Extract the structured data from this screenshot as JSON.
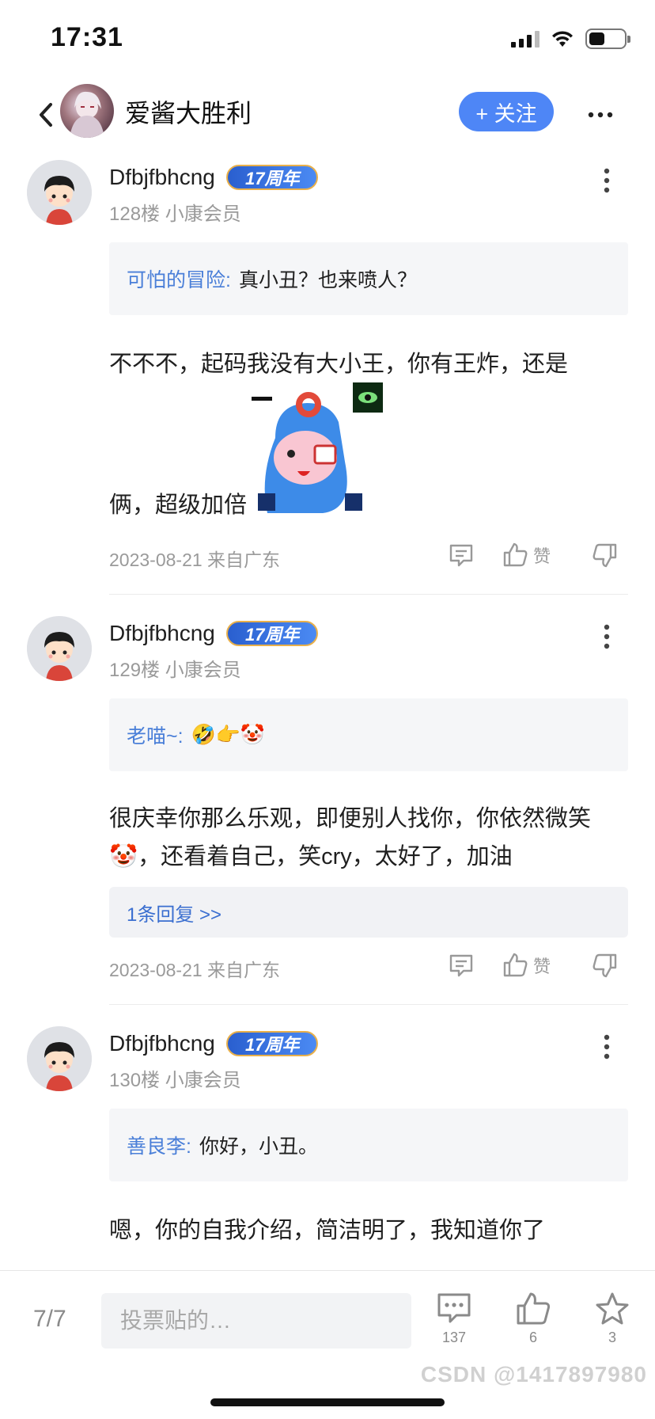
{
  "status_bar": {
    "time": "17:31",
    "battery_level": 0.45
  },
  "header": {
    "title": "爱酱大胜利",
    "follow_label": "+ 关注"
  },
  "posts": [
    {
      "username": "Dfbjfbhcng",
      "badge": "17周年",
      "floor": "128楼 小康会员",
      "quote_user": "可怕的冒险:",
      "quote_text": "真小丑？也来喷人？",
      "body_line1": "不不不，起码我没有大小王，你有王炸，还是",
      "body_line2": "俩，超级加倍",
      "sticker_icon": "meme-sticker-icon",
      "meta": "2023-08-21 来自广东",
      "like_label": "赞"
    },
    {
      "username": "Dfbjfbhcng",
      "badge": "17周年",
      "floor": "129楼 小康会员",
      "quote_user": "老喵~:",
      "quote_text": "🤣👉🤡",
      "body_line1": "很庆幸你那么乐观，即便别人找你，你依然微笑",
      "body_line2": "🤡，还看着自己，笑cry，太好了，加油",
      "replies_label": "1条回复 >>",
      "meta": "2023-08-21 来自广东",
      "like_label": "赞"
    },
    {
      "username": "Dfbjfbhcng",
      "badge": "17周年",
      "floor": "130楼 小康会员",
      "quote_user": "善良李:",
      "quote_text": "你好，小丑。",
      "body_line1": "嗯，你的自我介绍，简洁明了，我知道你了"
    }
  ],
  "bottom_bar": {
    "page": "7/7",
    "input_placeholder": "投票贴的…",
    "comment_count": "137",
    "like_count": "6",
    "star_count": "3"
  },
  "watermark": "CSDN @1417897980",
  "colors": {
    "accent": "#4e86f6",
    "quote_user": "#4a7fd8",
    "muted": "#9a9a9a"
  }
}
